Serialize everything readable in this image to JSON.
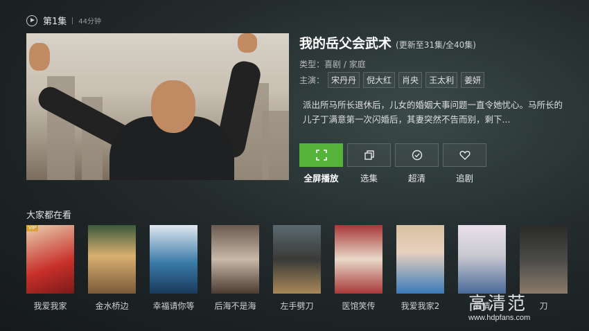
{
  "header": {
    "episode_label": "第1集",
    "duration": "44分钟"
  },
  "show": {
    "title": "我的岳父会武术",
    "update_status": "(更新至31集/全40集)",
    "type_label": "类型：",
    "type_value": "喜剧 / 家庭",
    "cast_label": "主演：",
    "cast": [
      "宋丹丹",
      "倪大红",
      "肖央",
      "王太利",
      "姜妍"
    ],
    "synopsis": "派出所马所长退休后，儿女的婚姻大事问题一直令她忧心。马所长的儿子丁满意第一次闪婚后，其妻突然不告而别，剩下..."
  },
  "actions": [
    {
      "label": "全屏播放",
      "icon": "fullscreen-icon",
      "active": true
    },
    {
      "label": "选集",
      "icon": "episodes-icon",
      "active": false
    },
    {
      "label": "超清",
      "icon": "quality-icon",
      "active": false
    },
    {
      "label": "追剧",
      "icon": "heart-icon",
      "active": false
    }
  ],
  "recommendations": {
    "title": "大家都在看",
    "items": [
      {
        "title": "我爱我家",
        "colors": [
          "#c8302a",
          "#e8d0b0"
        ]
      },
      {
        "title": "金水桥边",
        "colors": [
          "#7a5a3a",
          "#d8b070"
        ]
      },
      {
        "title": "幸福请你等",
        "colors": [
          "#3a7aa8",
          "#e0e8f0"
        ]
      },
      {
        "title": "后海不是海",
        "colors": [
          "#c8b8a8",
          "#4a3a30"
        ]
      },
      {
        "title": "左手劈刀",
        "colors": [
          "#3a3a38",
          "#a88858"
        ]
      },
      {
        "title": "医馆笑传",
        "colors": [
          "#a83838",
          "#e8d8c8"
        ]
      },
      {
        "title": "我爱我家2",
        "colors": [
          "#d8c0a0",
          "#3a7ab8"
        ]
      },
      {
        "title": "爱情",
        "colors": [
          "#c8c8d0",
          "#4a6a9a"
        ]
      },
      {
        "title": "刀",
        "colors": [
          "#4a4a48",
          "#8a7a6a"
        ]
      }
    ]
  },
  "watermark": {
    "logo": "高清范",
    "url": "www.hdpfans.com"
  }
}
